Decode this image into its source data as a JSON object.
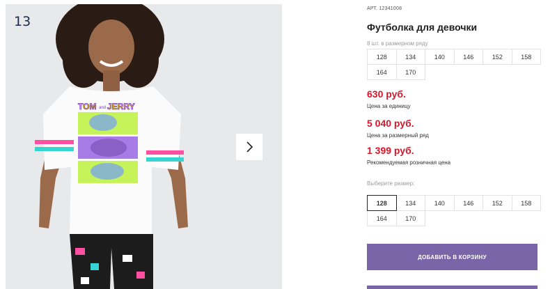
{
  "gallery": {
    "counter": "13",
    "next_icon": "chevron-right-icon",
    "print_top": "TOM",
    "print_mid": "and",
    "print_right": "JERRY"
  },
  "product": {
    "art": "АРТ.",
    "art_number": "12341008",
    "title": "Футболка для девочки",
    "row_note": "8 шт. в размерном ряду",
    "row_sizes": [
      "128",
      "134",
      "140",
      "146",
      "152",
      "158",
      "164",
      "170"
    ],
    "price_unit": "630 руб.",
    "price_unit_note": "Цена за единицу",
    "price_row": "5 040 руб.",
    "price_row_note": "Цена за размерный ряд",
    "price_retail": "1 399 руб.",
    "price_retail_note": "Рекомендуемая розничная цена",
    "choose_label": "Выберите размер:",
    "choose_sizes": [
      "128",
      "134",
      "140",
      "146",
      "152",
      "158",
      "164",
      "170"
    ],
    "selected_size": "128",
    "add_to_cart": "ДОБАВИТЬ В КОРЗИНУ"
  },
  "colors": {
    "price": "#d6162b",
    "button": "#7a65a8"
  }
}
